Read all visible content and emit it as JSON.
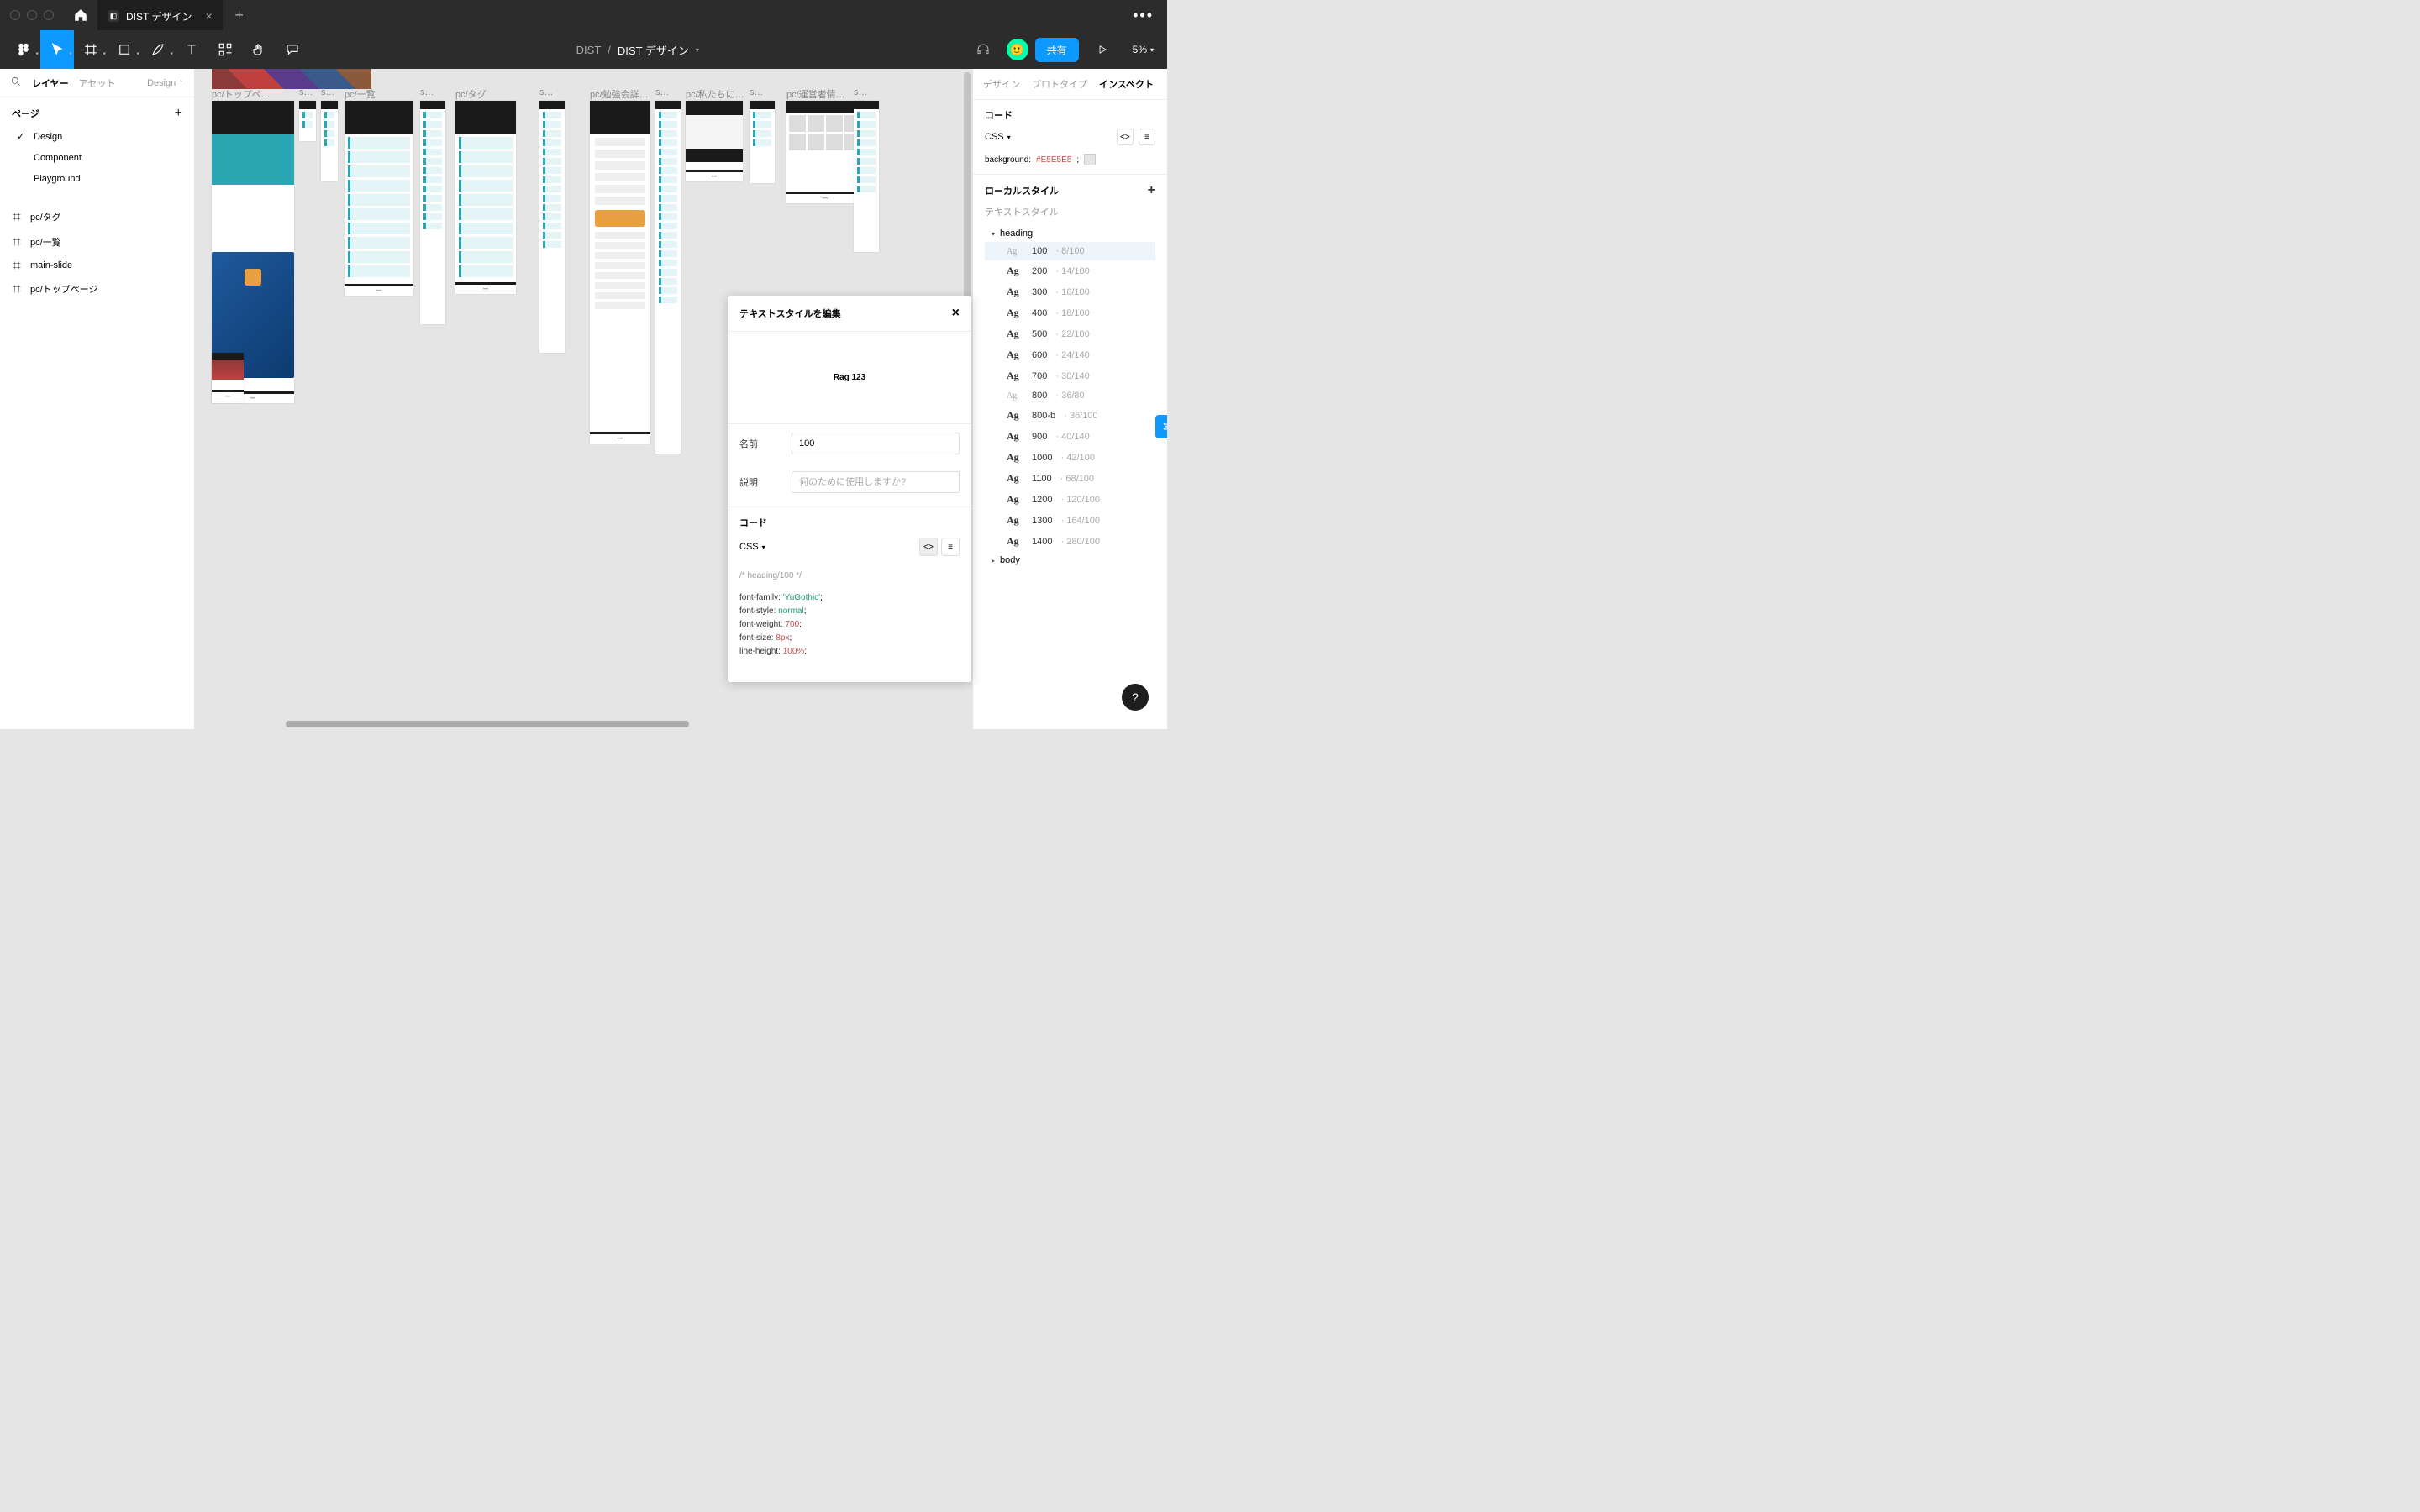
{
  "titlebar": {
    "tab_title": "DIST デザイン"
  },
  "toolbar": {
    "project": "DIST",
    "document": "DIST デザイン",
    "share": "共有",
    "zoom": "5%"
  },
  "left": {
    "tab_layers": "レイヤー",
    "tab_assets": "アセット",
    "design_select": "Design",
    "pages_header": "ページ",
    "pages": [
      {
        "name": "Design",
        "selected": true
      },
      {
        "name": "Component",
        "selected": false
      },
      {
        "name": "Playground",
        "selected": false
      }
    ],
    "layers": [
      "pc/タグ",
      "pc/一覧",
      "main-slide",
      "pc/トップページ"
    ]
  },
  "canvas": {
    "frames": [
      "pc/トップペ…",
      "s…",
      "s…",
      "pc/一覧",
      "s…",
      "pc/タグ",
      "s…",
      "pc/勉強会詳…",
      "s…",
      "pc/私たちに…",
      "s…",
      "pc/運営者情…",
      "s…"
    ]
  },
  "right": {
    "tab_design": "デザイン",
    "tab_proto": "プロトタイプ",
    "tab_inspect": "インスペクト",
    "code_header": "コード",
    "code_lang": "CSS",
    "code_line_prop": "background:",
    "code_line_val": "#E5E5E5",
    "local_styles": "ローカルスタイル",
    "text_styles": "テキストスタイル",
    "group_heading": "heading",
    "group_body": "body",
    "heading_items": [
      {
        "size": "100",
        "lh": "8/100",
        "light": true,
        "selected": true
      },
      {
        "size": "200",
        "lh": "14/100"
      },
      {
        "size": "300",
        "lh": "16/100"
      },
      {
        "size": "400",
        "lh": "18/100"
      },
      {
        "size": "500",
        "lh": "22/100",
        "bold": true
      },
      {
        "size": "600",
        "lh": "24/140"
      },
      {
        "size": "700",
        "lh": "30/140"
      },
      {
        "size": "800",
        "lh": "36/80",
        "light": true
      },
      {
        "size": "800-b",
        "lh": "36/100",
        "bold": true
      },
      {
        "size": "900",
        "lh": "40/140"
      },
      {
        "size": "1000",
        "lh": "42/100"
      },
      {
        "size": "1100",
        "lh": "68/100"
      },
      {
        "size": "1200",
        "lh": "120/100"
      },
      {
        "size": "1300",
        "lh": "164/100"
      },
      {
        "size": "1400",
        "lh": "280/100"
      }
    ]
  },
  "modal": {
    "title": "テキストスタイルを編集",
    "preview": "Rag 123",
    "name_label": "名前",
    "name_value": "100",
    "desc_label": "説明",
    "desc_placeholder": "何のために使用しますか?",
    "code_header": "コード",
    "code_lang": "CSS",
    "code_comment": "/* heading/100 */",
    "lines": [
      {
        "prop": "font-family:",
        "val": "'YuGothic'",
        "type": "str"
      },
      {
        "prop": "font-style:",
        "val": "normal",
        "type": "str"
      },
      {
        "prop": "font-weight:",
        "val": "700",
        "type": "num"
      },
      {
        "prop": "font-size:",
        "val": "8px",
        "type": "num"
      },
      {
        "prop": "line-height:",
        "val": "100%",
        "type": "num"
      }
    ]
  },
  "help": "?"
}
